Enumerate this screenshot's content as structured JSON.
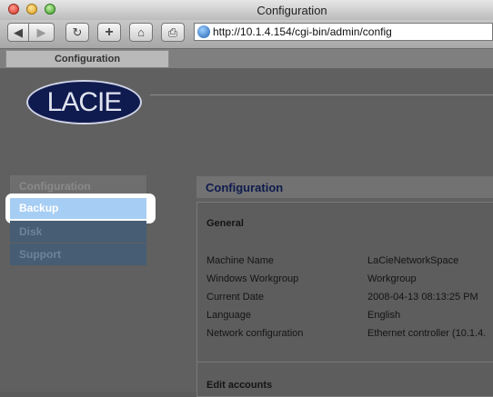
{
  "window": {
    "title": "Configuration"
  },
  "toolbar": {
    "back_icon": "◀",
    "forward_icon": "▶",
    "reload_icon": "↻",
    "add_icon": "+",
    "home_icon": "⌂",
    "print_icon": "⎙",
    "url": "http://10.1.4.154/cgi-bin/admin/config"
  },
  "tab": {
    "label": "Configuration"
  },
  "logo": {
    "text": "LACIE"
  },
  "nav": {
    "items": [
      {
        "label": "Configuration"
      },
      {
        "label": "Backup"
      },
      {
        "label": "Disk"
      },
      {
        "label": "Support"
      }
    ]
  },
  "panel": {
    "title": "Configuration",
    "section_general": "General",
    "rows": [
      {
        "label": "Machine Name",
        "value": "LaCieNetworkSpace"
      },
      {
        "label": "Windows Workgroup",
        "value": "Workgroup"
      },
      {
        "label": "Current Date",
        "value": "2008-04-13 08:13:25 PM"
      },
      {
        "label": "Language",
        "value": "English"
      },
      {
        "label": "Network configuration",
        "value": "Ethernet controller (10.1.4."
      }
    ],
    "section_edit": "Edit accounts"
  },
  "colors": {
    "highlight_item": "#a6cdf4",
    "logo_bg": "#0f1a4e",
    "panel_title": "#0d1b4e"
  }
}
